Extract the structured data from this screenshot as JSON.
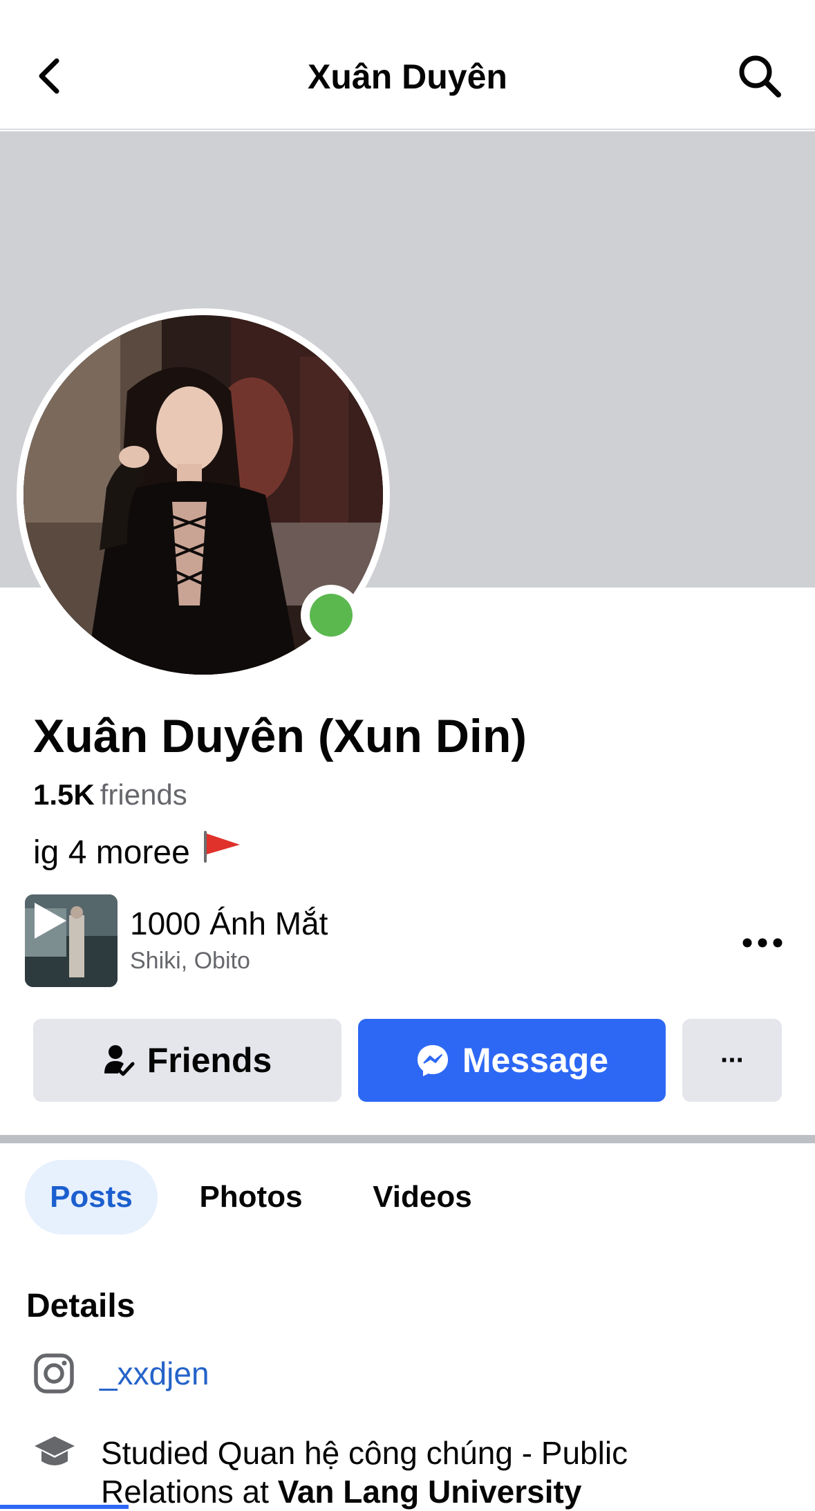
{
  "header": {
    "title": "Xuân Duyên",
    "back_icon": "chevron-left-icon",
    "search_icon": "search-icon"
  },
  "profile": {
    "name": "Xuân Duyên (Xun Din)",
    "friends_count": "1.5K",
    "friends_label": "friends",
    "bio": "ig 4 moree",
    "bio_emoji": "red-flag-icon",
    "online": true
  },
  "music": {
    "song": "1000 Ánh Mắt",
    "artist": "Shiki, Obito"
  },
  "actions": {
    "friends_label": "Friends",
    "message_label": "Message",
    "more_label": "···"
  },
  "tabs": [
    {
      "label": "Posts",
      "active": true
    },
    {
      "label": "Photos",
      "active": false
    },
    {
      "label": "Videos",
      "active": false
    }
  ],
  "details": {
    "heading": "Details",
    "instagram": "_xxdjen",
    "education_prefix": "Studied Quan hệ công chúng - Public Relations at ",
    "education_school": "Van Lang University"
  },
  "colors": {
    "accent": "#2d68f5",
    "cover": "#cfd0d4",
    "online": "#5bb84f",
    "link": "#2563c9"
  }
}
